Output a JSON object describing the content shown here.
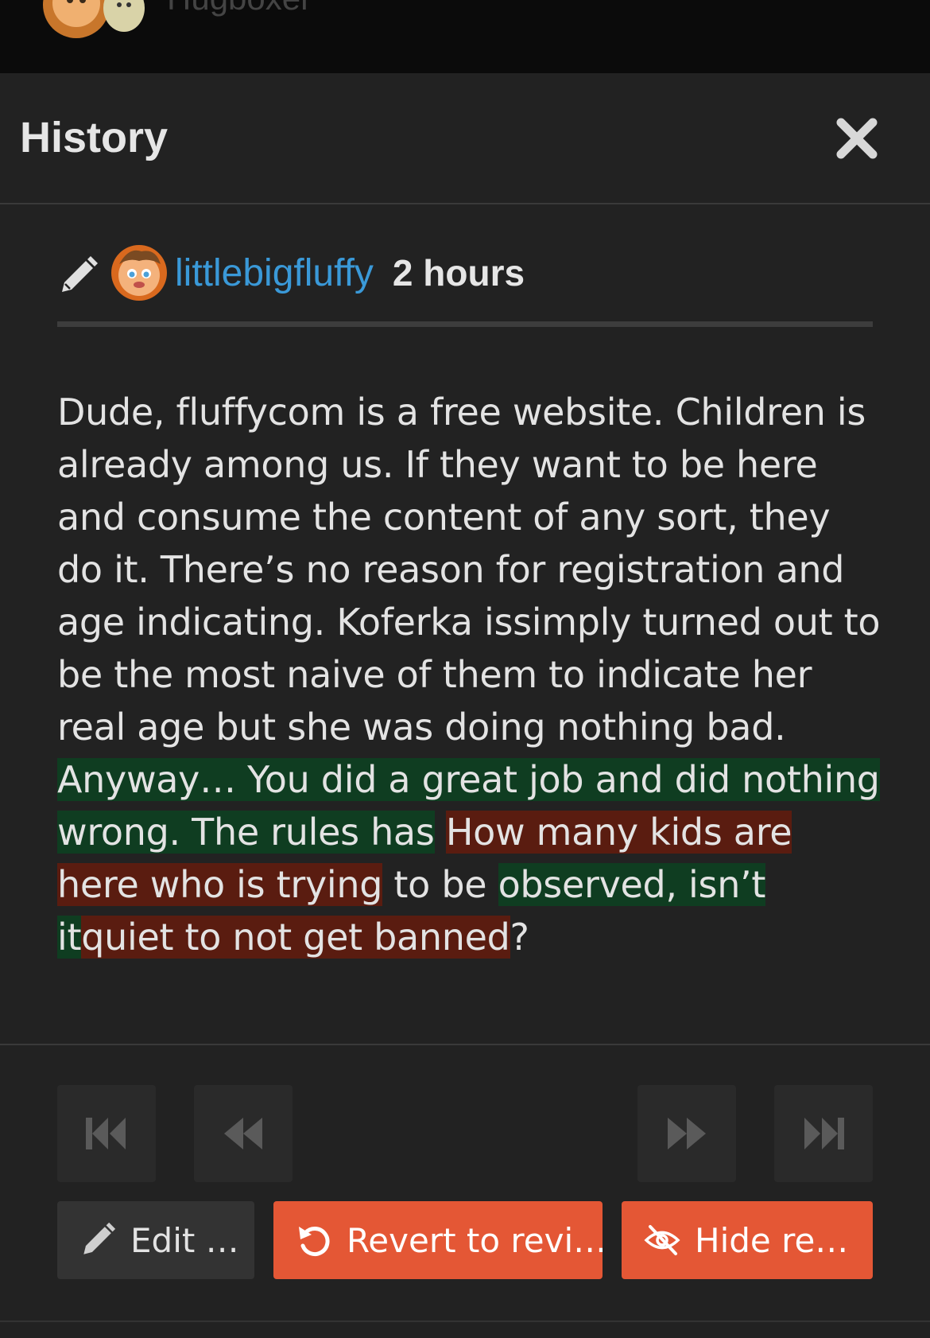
{
  "topbar": {
    "username": "Hugboxer"
  },
  "modal": {
    "title": "History"
  },
  "revision": {
    "author": "littlebigfluffy",
    "time": "2 hours"
  },
  "diff": {
    "segments": [
      {
        "type": "same",
        "text": "Dude, fluffycom is a free website. Children is already among us. If they want to be here and consume the content of any sort, they do it. There’s no reason for registration and age indicating. Koferka issimply turned out to be the most naive of them to indicate her real age but she was doing nothing bad. "
      },
      {
        "type": "ins",
        "text": "Anyway… You did a great job and did nothing wrong. The rules has"
      },
      {
        "type": "same",
        "text": " "
      },
      {
        "type": "del",
        "text": "How many kids are here who is trying"
      },
      {
        "type": "same",
        "text": " to be "
      },
      {
        "type": "ins",
        "text": "observed, isn’t it"
      },
      {
        "type": "del",
        "text": "quiet to not get banned"
      },
      {
        "type": "same",
        "text": "?"
      }
    ]
  },
  "navigation": {
    "first": "first-revision",
    "previous": "previous-revision",
    "next": "next-revision",
    "last": "last-revision"
  },
  "actions": {
    "edit_label": "Edit …",
    "revert_label": "Revert to revi…",
    "hide_label": "Hide re…"
  },
  "colors": {
    "accent": "#e45735",
    "link": "#3a99d8",
    "inserted_bg": "#0f3d21",
    "deleted_bg": "#5a1c10"
  }
}
